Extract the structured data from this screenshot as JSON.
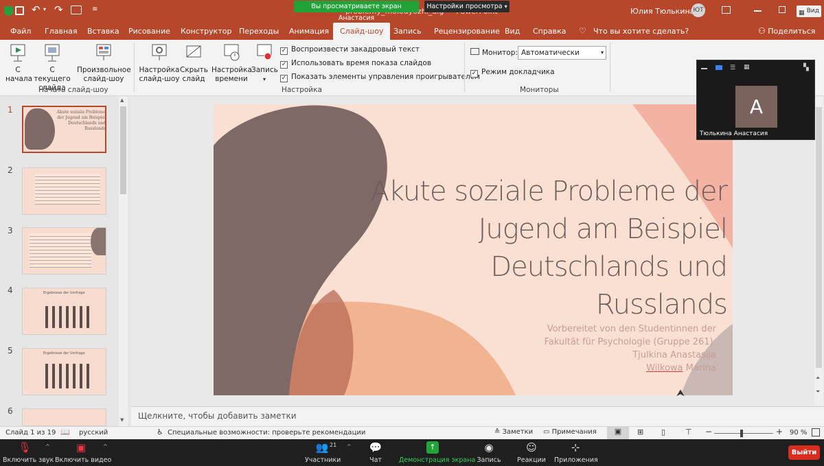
{
  "zoom_banner": {
    "viewing": "Вы просматриваете экран Анастасия",
    "view_options": "Настройки просмотра"
  },
  "title_bar": {
    "doc_title": "problemy_molodyozhi_dlg — PowerPoint",
    "user_name": "Юлия Тюлькина",
    "user_initials": "ЮТ",
    "share_label": "Вид"
  },
  "tabs": [
    "Файл",
    "Главная",
    "Вставка",
    "Рисование",
    "Конструктор",
    "Переходы",
    "Анимация",
    "Слайд-шоу",
    "Запись",
    "Рецензирование",
    "Вид",
    "Справка"
  ],
  "active_tab": "Слайд-шоу",
  "tell_me": "Что вы хотите сделать?",
  "share_button": "Поделиться",
  "ribbon": {
    "from_start": "С\nначала",
    "from_current": "С текущего\nслайда",
    "custom_show": "Произвольное\nслайд-шоу",
    "group_start": "Начать слайд-шоу",
    "setup_show": "Настройка\nслайд-шоу",
    "hide_slide": "Скрыть\nслайд",
    "rehearse": "Настройка\nвремени",
    "record": "Запись",
    "chk_narration": "Воспроизвести закадровый текст",
    "chk_timings": "Использовать время показа слайдов",
    "chk_controls": "Показать элементы управления проигрывателем",
    "group_setup": "Настройка",
    "monitor_label": "Монитор:",
    "monitor_value": "Автоматически",
    "presenter_view": "Режим докладчика",
    "group_monitors": "Мониторы"
  },
  "thumbnails": [
    {
      "num": "1",
      "title": "Akute soziale Probleme der Jugend am Beispiel Deutschlands und Russlands"
    },
    {
      "num": "2",
      "title": ""
    },
    {
      "num": "3",
      "title": ""
    },
    {
      "num": "4",
      "title": "Ergebnisse der Umfrage"
    },
    {
      "num": "5",
      "title": "Ergebnisse der Umfrage"
    },
    {
      "num": "6",
      "title": ""
    }
  ],
  "slide": {
    "title_l1": "Akute soziale Probleme der",
    "title_l2": "Jugend am Beispiel",
    "title_l3": "Deutschlands und",
    "title_l4": "Russlands",
    "sub_l1": "Vorbereitet von den Studentinnen der",
    "sub_l2": "Fakultät für Psychologie (Gruppe 261):",
    "sub_l3": "Tjulkina Anastasija",
    "sub_l4_a": "Wilkowa",
    "sub_l4_b": " Marina"
  },
  "notes_placeholder": "Щелкните, чтобы добавить заметки",
  "status": {
    "slide_of": "Слайд 1 из 19",
    "language": "русский",
    "accessibility": "Специальные возможности: проверьте рекомендации",
    "notes": "Заметки",
    "comments": "Примечания",
    "zoom": "90 %"
  },
  "video_tile": {
    "initial": "A",
    "name": "Тюлькина Анастасия"
  },
  "zoom_controls": {
    "mute": "Включить звук",
    "video": "Включить видео",
    "participants": "Участники",
    "participants_count": "21",
    "chat": "Чат",
    "share_screen": "Демонстрация экрана",
    "record": "Запись",
    "reactions": "Реакции",
    "apps": "Приложения",
    "leave": "Выйти"
  },
  "colors": {
    "powerpoint_accent": "#b7472a",
    "zoom_green": "#22a33a",
    "leave_red": "#d92d20",
    "slide_bg": "#f9e0d2"
  }
}
